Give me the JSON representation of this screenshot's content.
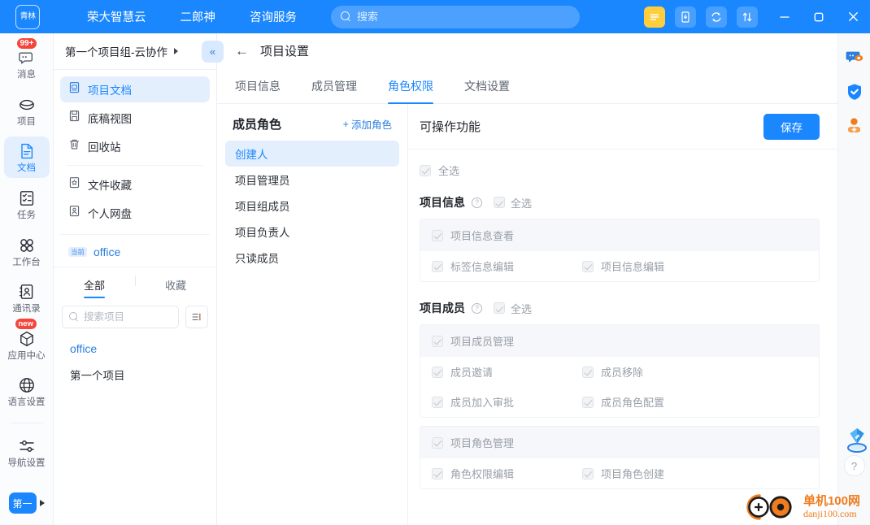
{
  "topbar": {
    "logo_text": "青林",
    "nav": [
      {
        "label": "荣大智慧云"
      },
      {
        "label": "二郎神"
      },
      {
        "label": "咨询服务"
      }
    ],
    "search": {
      "placeholder": "搜索",
      "value": ""
    },
    "icons": [
      {
        "name": "menu-icon"
      },
      {
        "name": "mobile-download-icon"
      },
      {
        "name": "sync-icon"
      },
      {
        "name": "transfer-icon"
      }
    ],
    "window_controls": [
      {
        "name": "minimize"
      },
      {
        "name": "maximize"
      },
      {
        "name": "close"
      }
    ]
  },
  "rail": {
    "items": [
      {
        "label": "消息",
        "icon": "message-icon",
        "badge": "99+",
        "active": false
      },
      {
        "label": "项目",
        "icon": "project-icon",
        "badge": "",
        "active": false
      },
      {
        "label": "文档",
        "icon": "document-icon",
        "badge": "",
        "active": true
      },
      {
        "label": "任务",
        "icon": "task-icon",
        "badge": "",
        "active": false
      },
      {
        "label": "工作台",
        "icon": "workbench-icon",
        "badge": "",
        "active": false
      },
      {
        "label": "通讯录",
        "icon": "contacts-icon",
        "badge": "",
        "active": false
      },
      {
        "label": "应用中心",
        "icon": "appcenter-icon",
        "badge": "new",
        "active": false
      },
      {
        "label": "语言设置",
        "icon": "language-icon",
        "badge": "",
        "active": false
      },
      {
        "label": "导航设置",
        "icon": "navsettings-icon",
        "badge": "",
        "active": false
      }
    ],
    "account_label": "第一"
  },
  "tree": {
    "group_title": "第一个项目组-云协作",
    "collapse_label": "«",
    "items": [
      {
        "label": "项目文档",
        "icon": "doc-blue-icon",
        "active": true
      },
      {
        "label": "底稿视图",
        "icon": "draft-icon",
        "active": false
      },
      {
        "label": "回收站",
        "icon": "trash-icon",
        "active": false
      },
      {
        "label": "文件收藏",
        "icon": "favorite-icon",
        "active": false
      },
      {
        "label": "个人网盘",
        "icon": "persondisk-icon",
        "active": false
      }
    ],
    "current": {
      "badge": "当前",
      "name": "office"
    },
    "tabs": [
      {
        "label": "全部",
        "active": true
      },
      {
        "label": "收藏",
        "active": false
      }
    ],
    "search": {
      "placeholder": "搜索项目",
      "value": ""
    },
    "projects": [
      {
        "label": "office",
        "highlight": true
      },
      {
        "label": "第一个项目",
        "highlight": false
      }
    ]
  },
  "main": {
    "back_icon": "←",
    "title": "项目设置",
    "tabs": [
      {
        "label": "项目信息",
        "active": false
      },
      {
        "label": "成员管理",
        "active": false
      },
      {
        "label": "角色权限",
        "active": true
      },
      {
        "label": "文档设置",
        "active": false
      }
    ]
  },
  "roles": {
    "title": "成员角色",
    "add_label": "添加角色",
    "add_icon": "+",
    "items": [
      {
        "label": "创建人",
        "active": true
      },
      {
        "label": "项目管理员",
        "active": false
      },
      {
        "label": "项目组成员",
        "active": false
      },
      {
        "label": "项目负责人",
        "active": false
      },
      {
        "label": "只读成员",
        "active": false
      }
    ]
  },
  "perms": {
    "title": "可操作功能",
    "save_label": "保存",
    "select_all_label": "全选",
    "select_all_checked": true,
    "groups": [
      {
        "name": "项目信息",
        "help_icon": "?",
        "select_all_label": "全选",
        "select_all_checked": true,
        "tables": [
          {
            "header": {
              "label": "项目信息查看",
              "checked": true
            },
            "rows": [
              [
                {
                  "label": "标签信息编辑",
                  "checked": true
                },
                {
                  "label": "项目信息编辑",
                  "checked": true
                }
              ]
            ]
          }
        ]
      },
      {
        "name": "项目成员",
        "help_icon": "?",
        "select_all_label": "全选",
        "select_all_checked": true,
        "tables": [
          {
            "header": {
              "label": "项目成员管理",
              "checked": true
            },
            "rows": [
              [
                {
                  "label": "成员邀请",
                  "checked": true
                },
                {
                  "label": "成员移除",
                  "checked": true
                }
              ],
              [
                {
                  "label": "成员加入审批",
                  "checked": true
                },
                {
                  "label": "成员角色配置",
                  "checked": true
                }
              ]
            ]
          },
          {
            "header": {
              "label": "项目角色管理",
              "checked": true
            },
            "rows": [
              [
                {
                  "label": "角色权限编辑",
                  "checked": true
                },
                {
                  "label": "项目角色创建",
                  "checked": true
                }
              ]
            ]
          }
        ]
      }
    ]
  },
  "right_rail": {
    "items": [
      {
        "name": "chat-assist-icon"
      },
      {
        "name": "shield-check-icon"
      },
      {
        "name": "add-user-icon"
      }
    ],
    "gem_icon": "gem-icon",
    "help_label": "?"
  },
  "watermark": {
    "line1": "单机100网",
    "line2": "danji100.com"
  },
  "colors": {
    "brand": "#1a87ff",
    "accent_light": "#e4effe",
    "badge_red": "#f5463c",
    "watermark_orange": "#f07c1e"
  }
}
